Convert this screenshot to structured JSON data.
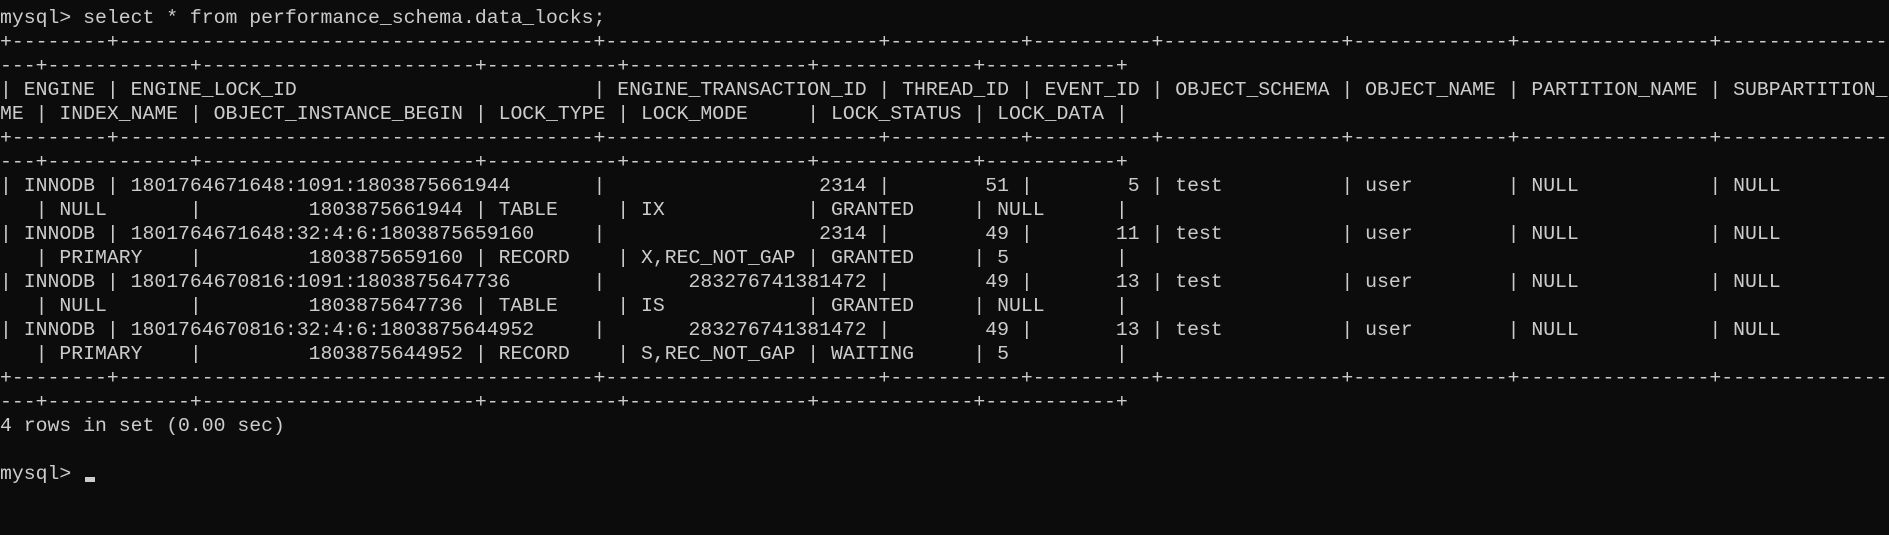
{
  "terminal": {
    "lines": [
      "mysql> select * from performance_schema.data_locks;",
      "+--------+----------------------------------------+-----------------------+-----------+----------+---------------+-------------+----------------+-------------------",
      "---+------------+-----------------------+-----------+---------------+-------------+-----------+",
      "| ENGINE | ENGINE_LOCK_ID                         | ENGINE_TRANSACTION_ID | THREAD_ID | EVENT_ID | OBJECT_SCHEMA | OBJECT_NAME | PARTITION_NAME | SUBPARTITION_NA",
      "ME | INDEX_NAME | OBJECT_INSTANCE_BEGIN | LOCK_TYPE | LOCK_MODE     | LOCK_STATUS | LOCK_DATA |",
      "+--------+----------------------------------------+-----------------------+-----------+----------+---------------+-------------+----------------+-------------------",
      "---+------------+-----------------------+-----------+---------------+-------------+-----------+",
      "| INNODB | 1801764671648:1091:1803875661944       |                  2314 |        51 |        5 | test          | user        | NULL           | NULL",
      "   | NULL       |         1803875661944 | TABLE     | IX            | GRANTED     | NULL      |",
      "| INNODB | 1801764671648:32:4:6:1803875659160     |                  2314 |        49 |       11 | test          | user        | NULL           | NULL",
      "   | PRIMARY    |         1803875659160 | RECORD    | X,REC_NOT_GAP | GRANTED     | 5         |",
      "| INNODB | 1801764670816:1091:1803875647736       |       283276741381472 |        49 |       13 | test          | user        | NULL           | NULL",
      "   | NULL       |         1803875647736 | TABLE     | IS            | GRANTED     | NULL      |",
      "| INNODB | 1801764670816:32:4:6:1803875644952     |       283276741381472 |        49 |       13 | test          | user        | NULL           | NULL",
      "   | PRIMARY    |         1803875644952 | RECORD    | S,REC_NOT_GAP | WAITING     | 5         |",
      "+--------+----------------------------------------+-----------------------+-----------+----------+---------------+-------------+----------------+-------------------",
      "---+------------+-----------------------+-----------+---------------+-------------+-----------+",
      "4 rows in set (0.00 sec)",
      "",
      "mysql> "
    ]
  }
}
